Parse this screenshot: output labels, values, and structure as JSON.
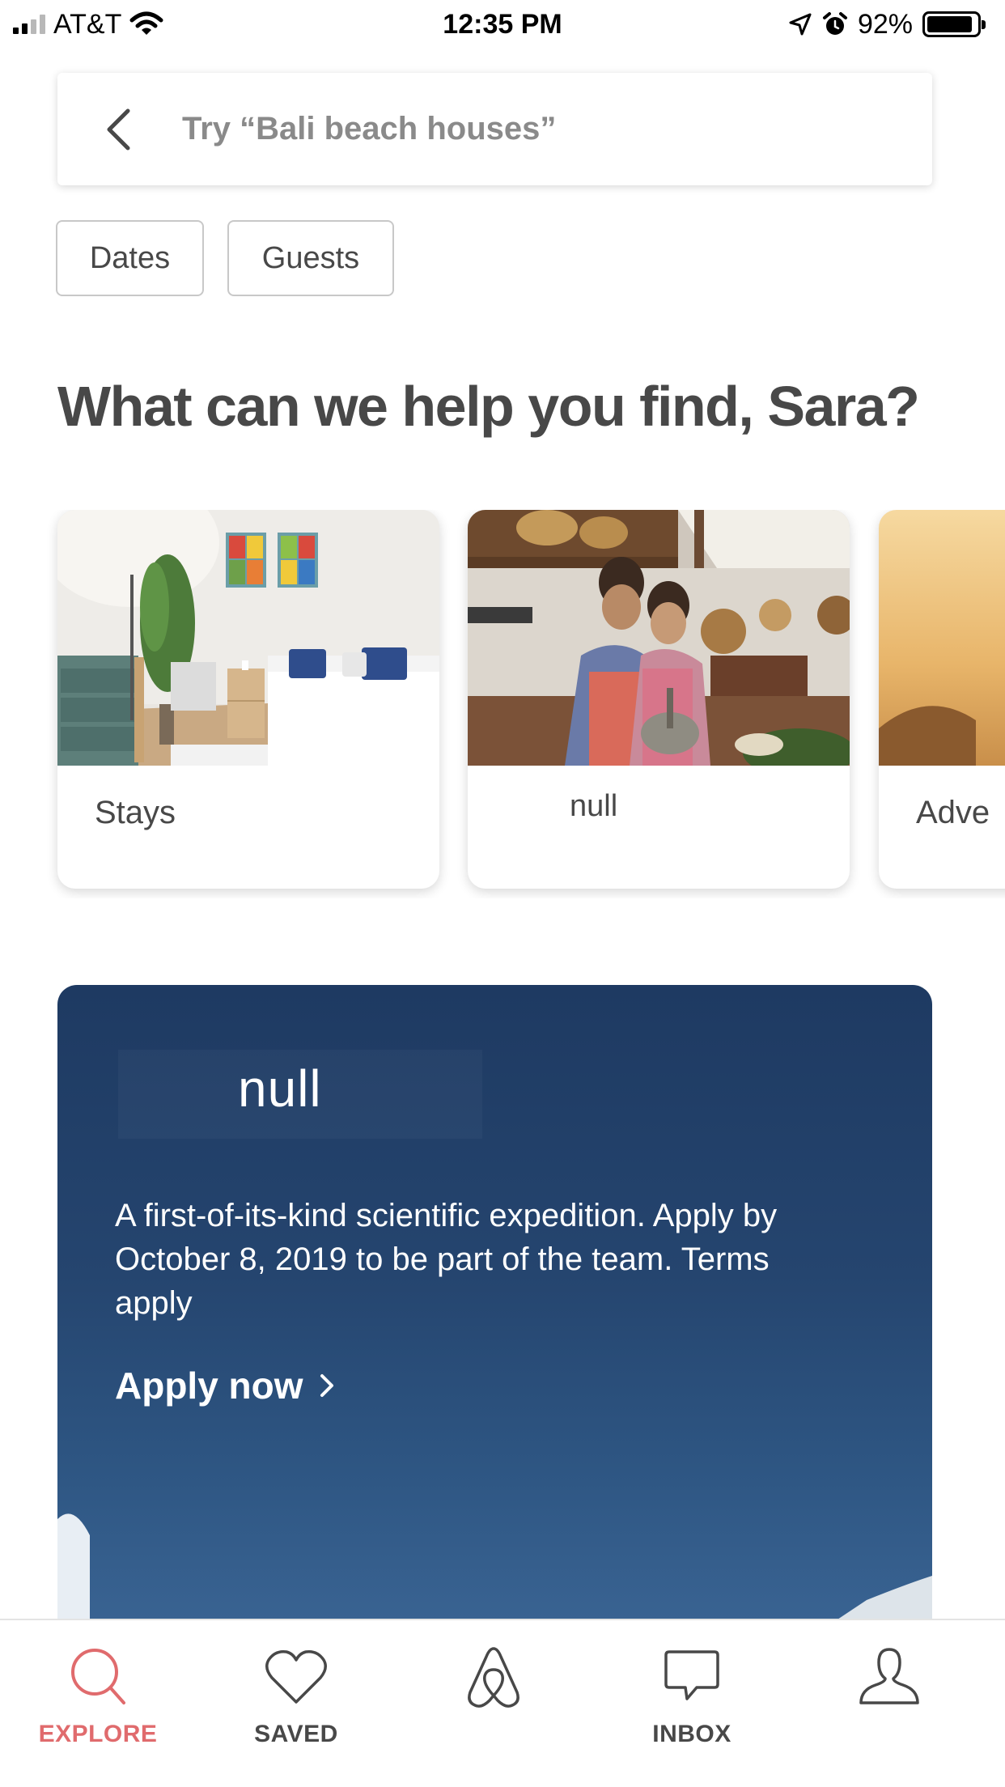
{
  "status_bar": {
    "carrier": "AT&T",
    "time": "12:35 PM",
    "battery": "92%",
    "battery_level": 0.92
  },
  "search": {
    "placeholder": "Try “Bali beach houses”"
  },
  "filters": {
    "dates": "Dates",
    "guests": "Guests"
  },
  "headline": "What can we help you find, Sara?",
  "categories": [
    {
      "label": "Stays"
    },
    {
      "label": "null"
    },
    {
      "label": "Adve"
    }
  ],
  "promo": {
    "title": "null",
    "body": "A first-of-its-kind scientific expedition. Apply by October 8, 2019 to be part of the team. Terms apply",
    "cta": "Apply now"
  },
  "tabs": [
    {
      "label": "EXPLORE",
      "icon": "search-icon",
      "active": true
    },
    {
      "label": "SAVED",
      "icon": "heart-icon",
      "active": false
    },
    {
      "label": "",
      "icon": "airbnb-logo-icon",
      "active": false
    },
    {
      "label": "INBOX",
      "icon": "chat-bubble-icon",
      "active": false
    },
    {
      "label": "",
      "icon": "profile-icon",
      "active": false
    }
  ],
  "colors": {
    "accent": "#e06b6d",
    "text": "#484848",
    "promo_background": "#25456f"
  }
}
